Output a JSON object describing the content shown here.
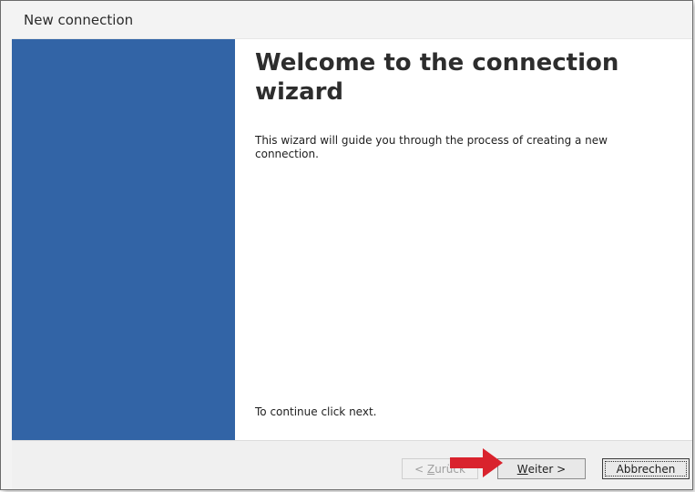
{
  "window": {
    "title": "New connection"
  },
  "wizard": {
    "heading": "Welcome to the connection wizard",
    "intro": "This wizard will guide you through the process of creating a new connection.",
    "continue_hint": "To continue click next."
  },
  "buttons": {
    "back": {
      "mnemonic": "Z",
      "rest": "urück",
      "prefix": "< "
    },
    "next": {
      "mnemonic": "W",
      "rest": "eiter >"
    },
    "cancel": "Abbrechen"
  },
  "colors": {
    "side_panel": "#3264a6",
    "annotation_arrow": "#d9232d"
  },
  "annotation": {
    "icon": "red-arrow-icon"
  }
}
